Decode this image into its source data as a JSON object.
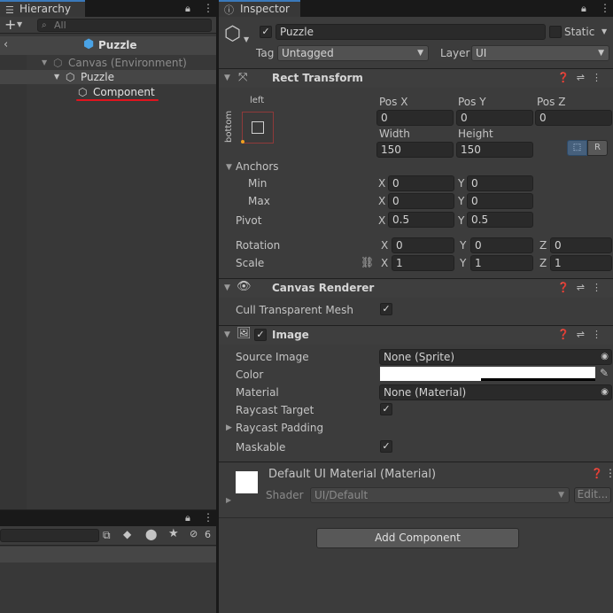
{
  "hierarchy": {
    "tab_label": "Hierarchy",
    "search_placeholder": "All",
    "scene_title": "Puzzle",
    "tree": [
      {
        "label": "Canvas (Environment)"
      },
      {
        "label": "Puzzle"
      },
      {
        "label": "Component"
      }
    ]
  },
  "lower_panel": {
    "hidden_count": "6"
  },
  "inspector": {
    "tab_label": "Inspector",
    "object_name": "Puzzle",
    "static_label": "Static",
    "tag_label": "Tag",
    "tag_value": "Untagged",
    "layer_label": "Layer",
    "layer_value": "UI",
    "rect_transform": {
      "title": "Rect Transform",
      "anchor_preset_top": "left",
      "anchor_preset_side": "bottom",
      "pos_x_label": "Pos X",
      "pos_x": "0",
      "pos_y_label": "Pos Y",
      "pos_y": "0",
      "pos_z_label": "Pos Z",
      "pos_z": "0",
      "width_label": "Width",
      "width": "150",
      "height_label": "Height",
      "height": "150",
      "raw_edit_label": "R",
      "anchors_label": "Anchors",
      "min_label": "Min",
      "min_x": "0",
      "min_y": "0",
      "max_label": "Max",
      "max_x": "0",
      "max_y": "0",
      "pivot_label": "Pivot",
      "pivot_x": "0.5",
      "pivot_y": "0.5",
      "rotation_label": "Rotation",
      "rot_x": "0",
      "rot_y": "0",
      "rot_z": "0",
      "scale_label": "Scale",
      "scale_x": "1",
      "scale_y": "1",
      "scale_z": "1",
      "x": "X",
      "y": "Y",
      "z": "Z"
    },
    "canvas_renderer": {
      "title": "Canvas Renderer",
      "cull_label": "Cull Transparent Mesh",
      "cull_checked": true
    },
    "image": {
      "title": "Image",
      "source_image_label": "Source Image",
      "source_image_value": "None (Sprite)",
      "color_label": "Color",
      "color_value": "#ffffff",
      "material_label": "Material",
      "material_value": "None (Material)",
      "raycast_target_label": "Raycast Target",
      "raycast_padding_label": "Raycast Padding",
      "maskable_label": "Maskable"
    },
    "material_section": {
      "title": "Default UI Material (Material)",
      "shader_label": "Shader",
      "shader_value": "UI/Default",
      "edit_label": "Edit..."
    },
    "add_component_label": "Add Component"
  },
  "colors": {
    "selection_underline": "#e0141e",
    "accent_tab": "#3a79bb"
  }
}
